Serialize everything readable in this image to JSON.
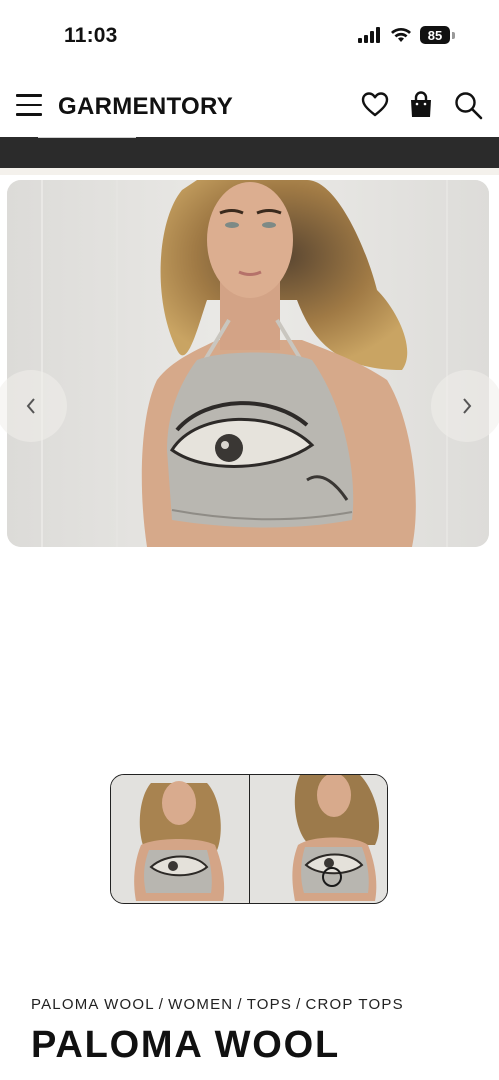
{
  "status_bar": {
    "time": "11:03",
    "battery": "85"
  },
  "header": {
    "logo": "GARMENTORY"
  },
  "icons": {
    "menu": "hamburger-menu-icon",
    "wishlist": "heart-icon",
    "cart": "shopping-bag-icon",
    "search": "search-icon",
    "prev": "chevron-left-icon",
    "next": "chevron-right-icon"
  },
  "breadcrumb": [
    {
      "label": "PALOMA WOOL"
    },
    {
      "label": "WOMEN"
    },
    {
      "label": "TOPS"
    },
    {
      "label": "CROP TOPS"
    }
  ],
  "breadcrumb_separator": "/",
  "product": {
    "brand": "PALOMA WOOL"
  },
  "colors": {
    "banner": "#2b2b2b",
    "text": "#111111",
    "image_bg": "#e3e2df"
  }
}
